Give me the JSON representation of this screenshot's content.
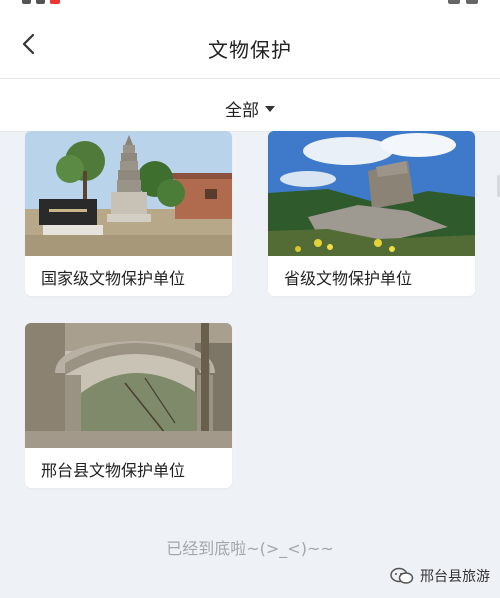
{
  "header": {
    "title": "文物保护",
    "back_icon": "chevron-left-icon"
  },
  "filter": {
    "label": "全部",
    "caret_icon": "caret-down-icon"
  },
  "categories": [
    {
      "label": "国家级文物保护单位"
    },
    {
      "label": "省级文物保护单位"
    },
    {
      "label": "邢台县文物保护单位"
    }
  ],
  "footer": {
    "end_message": "已经到底啦~(>_<)~~"
  },
  "watermark": {
    "text": "邢台县旅游",
    "icon": "wechat-icon"
  }
}
